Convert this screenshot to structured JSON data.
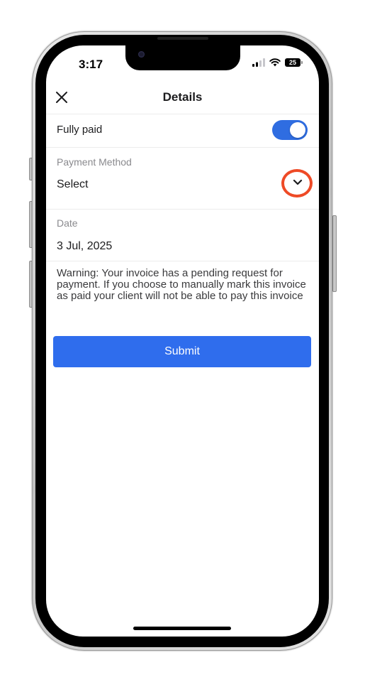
{
  "status_bar": {
    "time": "3:17",
    "battery": "25",
    "icons": [
      "signal-icon",
      "wifi-icon",
      "battery-icon"
    ]
  },
  "header": {
    "title": "Details",
    "close_icon": "close-icon"
  },
  "fully_paid": {
    "label": "Fully paid",
    "toggle_on": true
  },
  "payment_method": {
    "label": "Payment Method",
    "value": "Select",
    "icon": "chevron-down-icon"
  },
  "date": {
    "label": "Date",
    "value": "3 Jul, 2025"
  },
  "warning": {
    "text": "Warning: Your invoice has a pending request for payment. If you choose to manually mark this invoice as paid your client will not be able to pay this invoice"
  },
  "submit": {
    "label": "Submit"
  },
  "colors": {
    "accent": "#2f6ded",
    "toggle": "#2f6de1",
    "highlight": "#ee4a26"
  }
}
